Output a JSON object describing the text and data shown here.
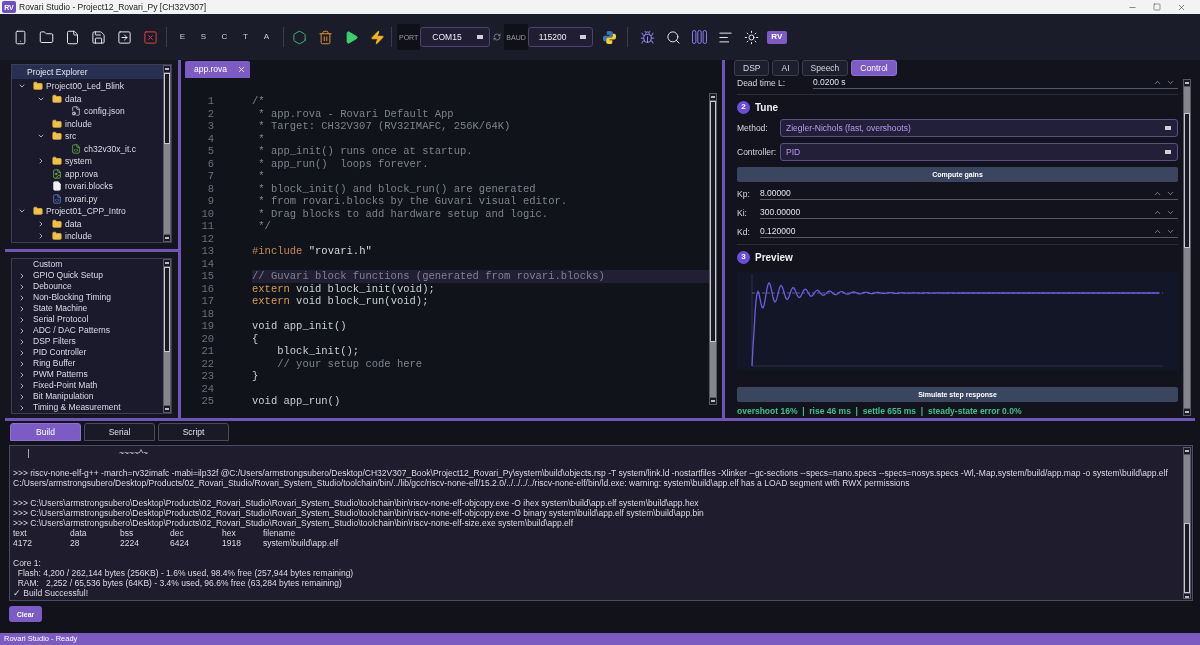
{
  "window": {
    "app_icon": "RV",
    "title": "Rovari Studio - Project12_Rovari_Py [CH32V307]"
  },
  "toolbar": {
    "letter_buttons": [
      "E",
      "S",
      "C",
      "T",
      "A"
    ],
    "port": {
      "label": "PORT",
      "value": "COM15"
    },
    "baud": {
      "label": "BAUD",
      "value": "115200"
    },
    "badge": "RV"
  },
  "explorer": {
    "title": "Project Explorer",
    "tree": [
      {
        "label": "Project00_Led_Blink",
        "kind": "folder",
        "expanded": true,
        "children": [
          {
            "label": "data",
            "kind": "folder",
            "expanded": true,
            "children": [
              {
                "label": "config.json",
                "kind": "config"
              }
            ]
          },
          {
            "label": "include",
            "kind": "folder"
          },
          {
            "label": "src",
            "kind": "folder",
            "expanded": true,
            "children": [
              {
                "label": "ch32v30x_it.c",
                "kind": "source"
              }
            ]
          },
          {
            "label": "system",
            "kind": "folder",
            "expanded": false
          },
          {
            "label": "app.rova",
            "kind": "app"
          },
          {
            "label": "rovari.blocks",
            "kind": "blocks"
          },
          {
            "label": "rovari.py",
            "kind": "script"
          }
        ]
      },
      {
        "label": "Project01_CPP_Intro",
        "kind": "folder",
        "expanded": true,
        "children": [
          {
            "label": "data",
            "kind": "folder",
            "expanded": false
          },
          {
            "label": "include",
            "kind": "folder",
            "expanded": false
          }
        ]
      }
    ]
  },
  "snippets": [
    {
      "label": "Custom"
    },
    {
      "label": "GPIO Quick Setup",
      "expanded": false
    },
    {
      "label": "Debounce",
      "expanded": false
    },
    {
      "label": "Non-Blocking Timing",
      "expanded": false
    },
    {
      "label": "State Machine",
      "expanded": false
    },
    {
      "label": "Serial Protocol",
      "expanded": false
    },
    {
      "label": "ADC / DAC Patterns",
      "expanded": false
    },
    {
      "label": "DSP Filters",
      "expanded": false
    },
    {
      "label": "PID Controller",
      "expanded": false
    },
    {
      "label": "Ring Buffer",
      "expanded": false
    },
    {
      "label": "PWM Patterns",
      "expanded": false
    },
    {
      "label": "Fixed-Point Math",
      "expanded": false
    },
    {
      "label": "Bit Manipulation",
      "expanded": false
    },
    {
      "label": "Timing & Measurement",
      "expanded": false
    }
  ],
  "editor": {
    "tabs": [
      {
        "label": "app.rova",
        "selected": true
      }
    ],
    "lines": [
      {
        "number": "1",
        "highlighted": false,
        "segments": [
          {
            "kind": "comment",
            "text": "/*"
          }
        ]
      },
      {
        "number": "2",
        "highlighted": false,
        "segments": [
          {
            "kind": "comment",
            "text": " * app.rova - Rovari Default App"
          }
        ]
      },
      {
        "number": "3",
        "highlighted": false,
        "segments": [
          {
            "kind": "comment",
            "text": " * Target: CH32V307 (RV32IMAFC, 256K/64K)"
          }
        ]
      },
      {
        "number": "4",
        "highlighted": false,
        "segments": [
          {
            "kind": "comment",
            "text": " *"
          }
        ]
      },
      {
        "number": "5",
        "highlighted": false,
        "segments": [
          {
            "kind": "comment",
            "text": " * app_init() runs once at startup."
          }
        ]
      },
      {
        "number": "6",
        "highlighted": false,
        "segments": [
          {
            "kind": "comment",
            "text": " * app_run()  loops forever."
          }
        ]
      },
      {
        "number": "7",
        "highlighted": false,
        "segments": [
          {
            "kind": "comment",
            "text": " *"
          }
        ]
      },
      {
        "number": "8",
        "highlighted": false,
        "segments": [
          {
            "kind": "comment",
            "text": " * block_init() and block_run() are generated"
          }
        ]
      },
      {
        "number": "9",
        "highlighted": false,
        "segments": [
          {
            "kind": "comment",
            "text": " * from rovari.blocks by the Guvari visual editor."
          }
        ]
      },
      {
        "number": "10",
        "highlighted": false,
        "segments": [
          {
            "kind": "comment",
            "text": " * Drag blocks to add hardware setup and logic."
          }
        ]
      },
      {
        "number": "11",
        "highlighted": false,
        "segments": [
          {
            "kind": "comment",
            "text": " */"
          }
        ]
      },
      {
        "number": "12",
        "highlighted": false
      },
      {
        "number": "13",
        "highlighted": false,
        "segments": [
          {
            "kind": "preprocessor",
            "text": "#include"
          },
          {
            "kind": "string",
            "text": " \"rovari.h\""
          }
        ]
      },
      {
        "number": "14",
        "highlighted": false
      },
      {
        "number": "15",
        "highlighted": true,
        "segments": [
          {
            "kind": "comment",
            "text": "// Guvari block functions (generated from rovari.blocks)"
          }
        ]
      },
      {
        "number": "16",
        "highlighted": false,
        "segments": [
          {
            "kind": "keyword",
            "text": "extern"
          },
          {
            "kind": "plain",
            "text": " void block_init(void);"
          }
        ]
      },
      {
        "number": "17",
        "highlighted": false,
        "segments": [
          {
            "kind": "keyword",
            "text": "extern"
          },
          {
            "kind": "plain",
            "text": " void block_run(void);"
          }
        ]
      },
      {
        "number": "18",
        "highlighted": false
      },
      {
        "number": "19",
        "highlighted": false,
        "segments": [
          {
            "kind": "plain",
            "text": "void app_init()"
          }
        ]
      },
      {
        "number": "20",
        "highlighted": false,
        "segments": [
          {
            "kind": "plain",
            "text": "{"
          }
        ]
      },
      {
        "number": "21",
        "highlighted": false,
        "segments": [
          {
            "kind": "plain",
            "text": "    block_init();"
          }
        ]
      },
      {
        "number": "22",
        "highlighted": false,
        "segments": [
          {
            "kind": "comment",
            "text": "    // your setup code here"
          }
        ]
      },
      {
        "number": "23",
        "highlighted": false,
        "segments": [
          {
            "kind": "plain",
            "text": "}"
          }
        ]
      },
      {
        "number": "24",
        "highlighted": false
      },
      {
        "number": "25",
        "highlighted": false,
        "segments": [
          {
            "kind": "plain",
            "text": "void app_run()"
          }
        ]
      }
    ]
  },
  "control_panel": {
    "tabs": [
      {
        "label": "DSP",
        "selected": false
      },
      {
        "label": "AI",
        "selected": false
      },
      {
        "label": "Speech",
        "selected": false
      },
      {
        "label": "Control",
        "selected": true
      }
    ],
    "dead_time": {
      "label": "Dead time L:",
      "value": "0.0200 s"
    },
    "tune": {
      "step": "2",
      "title": "Tune",
      "method": {
        "label": "Method:",
        "value": "Ziegler-Nichols (fast, overshoots)"
      },
      "controller": {
        "label": "Controller:",
        "value": "PID"
      },
      "compute_button": "Compute gains",
      "gains": [
        {
          "label": "Kp:",
          "value": "8.00000"
        },
        {
          "label": "Ki:",
          "value": "300.00000"
        },
        {
          "label": "Kd:",
          "value": "0.120000"
        }
      ]
    },
    "preview": {
      "step": "3",
      "title": "Preview",
      "simulate_button": "Simulate step response",
      "stats": "overshoot 16%  |  rise 46 ms  |  settle 655 ms  |  steady-state error 0.0%"
    }
  },
  "output": {
    "tabs": [
      {
        "label": "Build",
        "selected": true
      },
      {
        "label": "Serial",
        "selected": false
      },
      {
        "label": "Script",
        "selected": false
      }
    ],
    "lines": [
      {
        "kind": "text",
        "text": "      |                                      ~~~~^~"
      },
      {
        "kind": "blank"
      },
      {
        "kind": "text",
        "text": ">>> riscv-none-elf-g++ -march=rv32imafc -mabi=ilp32f @C:/Users/armstrongsubero/Desktop/CH32V307_Book\\Project12_Rovari_Py\\system\\build\\objects.rsp -T system/link.ld -nostartfiles -Xlinker --gc-sections --specs=nano.specs --specs=nosys.specs -Wl,-Map,system/build/app.map -o system\\build\\app.elf"
      },
      {
        "kind": "text",
        "text": "C:/Users/armstrongsubero/Desktop/Products/02_Rovari_Studio/Rovari_System_Studio/toolchain/bin/../lib/gcc/riscv-none-elf/15.2.0/../../../../riscv-none-elf/bin/ld.exe: warning: system\\build\\app.elf has a LOAD segment with RWX permissions"
      },
      {
        "kind": "blank"
      },
      {
        "kind": "text",
        "text": ">>> C:\\Users\\armstrongsubero\\Desktop\\Products\\02_Rovari_Studio\\Rovari_System_Studio\\toolchain\\bin\\riscv-none-elf-objcopy.exe -O ihex system\\build\\app.elf system\\build\\app.hex"
      },
      {
        "kind": "text",
        "text": ">>> C:\\Users\\armstrongsubero\\Desktop\\Products\\02_Rovari_Studio\\Rovari_System_Studio\\toolchain\\bin\\riscv-none-elf-objcopy.exe -O binary system\\build\\app.elf system\\build\\app.bin"
      },
      {
        "kind": "text",
        "text": ">>> C:\\Users\\armstrongsubero\\Desktop\\Products\\02_Rovari_Studio\\Rovari_System_Studio\\toolchain\\bin\\riscv-none-elf-size.exe system\\build\\app.elf"
      },
      {
        "kind": "columns",
        "cells": [
          "text",
          "data",
          "bss",
          "dec",
          "hex",
          "filename"
        ]
      },
      {
        "kind": "columns",
        "cells": [
          "4172",
          "28",
          "2224",
          "6424",
          "1918",
          "system\\build\\app.elf"
        ]
      },
      {
        "kind": "blank"
      },
      {
        "kind": "text",
        "text": "Core 1:"
      },
      {
        "kind": "text",
        "text": "  Flash: 4,200 / 262,144 bytes (256KB) - 1.6% used, 98.4% free (257,944 bytes remaining)"
      },
      {
        "kind": "text",
        "text": "  RAM:   2,252 / 65,536 bytes (64KB) - 3.4% used, 96.6% free (63,284 bytes remaining)"
      },
      {
        "kind": "text",
        "text": "✓ Build Successful!"
      }
    ],
    "clear_button": "Clear"
  },
  "status_bar": {
    "text": "Rovari Studio - Ready"
  }
}
